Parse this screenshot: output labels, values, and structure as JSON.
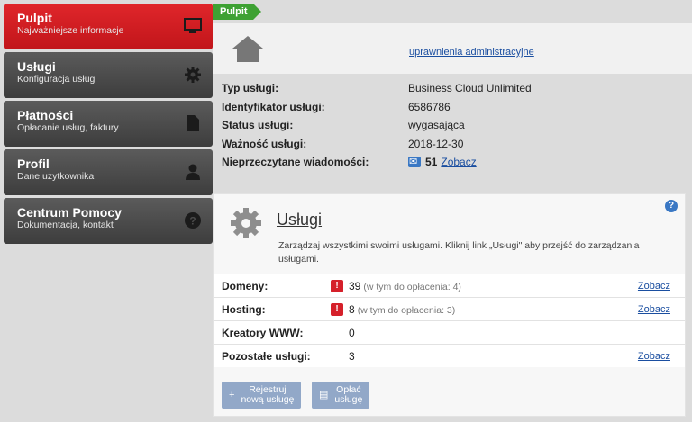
{
  "sidebar": {
    "items": [
      {
        "title": "Pulpit",
        "subtitle": "Najważniejsze informacje",
        "icon": "monitor-icon"
      },
      {
        "title": "Usługi",
        "subtitle": "Konfiguracja usług",
        "icon": "gear-icon"
      },
      {
        "title": "Płatności",
        "subtitle": "Opłacanie usług, faktury",
        "icon": "document-icon"
      },
      {
        "title": "Profil",
        "subtitle": "Dane użytkownika",
        "icon": "user-icon"
      },
      {
        "title": "Centrum Pomocy",
        "subtitle": "Dokumentacja, kontakt",
        "icon": "help-icon"
      }
    ]
  },
  "breadcrumb": "Pulpit",
  "header": {
    "admin_link": "uprawnienia administracyjne"
  },
  "info": {
    "service_type_label": "Typ usługi:",
    "service_type": "Business Cloud Unlimited",
    "service_id_label": "Identyfikator usługi:",
    "service_id": "6586786",
    "status_label": "Status usługi:",
    "status": "wygasająca",
    "validity_label": "Ważność usługi:",
    "validity": "2018-12-30",
    "messages_label": "Nieprzeczytane wiadomości:",
    "messages_count": "51",
    "messages_link": "Zobacz"
  },
  "services": {
    "title": "Usługi",
    "description": "Zarządzaj wszystkimi swoimi usługami. Kliknij link „Usługi\" aby przejść do zarządzania usługami.",
    "help": "?",
    "rows": [
      {
        "name": "Domeny:",
        "count": "39",
        "note": "(w tym do opłacenia: 4)",
        "link": "Zobacz"
      },
      {
        "name": "Hosting:",
        "count": "8",
        "note": "(w tym do opłacenia: 3)",
        "link": "Zobacz"
      },
      {
        "name": "Kreatory WWW:",
        "count": "0"
      },
      {
        "name": "Pozostałe usługi:",
        "count": "3",
        "link": "Zobacz"
      }
    ],
    "register_line1": "Rejestruj",
    "register_line2": "nową usługę",
    "pay_line1": "Opłać",
    "pay_line2": "usługę"
  },
  "colors": {
    "active": "#d21c22",
    "nav": "#4a4a4a",
    "accent_green": "#3ea133",
    "link": "#1a4ea0",
    "warning": "#d5202a"
  }
}
